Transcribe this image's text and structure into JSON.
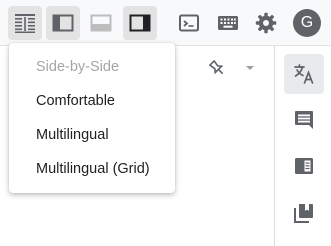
{
  "toolbar": {
    "buttons": [
      {
        "icon": "side-by-side-layout-icon",
        "active": true
      },
      {
        "icon": "left-panel-layout-icon",
        "active": true
      },
      {
        "icon": "bottom-panel-layout-icon",
        "active": false
      },
      {
        "icon": "right-panel-layout-icon",
        "active": true
      },
      {
        "icon": "terminal-icon",
        "active": false
      },
      {
        "icon": "keyboard-icon",
        "active": false
      },
      {
        "icon": "gear-icon",
        "active": false
      }
    ],
    "avatar_letter": "G"
  },
  "layout_menu": {
    "items": [
      {
        "label": "Side-by-Side",
        "disabled": true
      },
      {
        "label": "Comfortable",
        "disabled": false
      },
      {
        "label": "Multilingual",
        "disabled": false
      },
      {
        "label": "Multilingual (Grid)",
        "disabled": false
      }
    ]
  },
  "right_sidebar": {
    "buttons": [
      {
        "icon": "translate-icon",
        "active": true
      },
      {
        "icon": "comment-icon",
        "active": false
      },
      {
        "icon": "book-icon",
        "active": false
      },
      {
        "icon": "bookmarks-icon",
        "active": false
      }
    ]
  },
  "colors": {
    "icon": "#5f6368",
    "active_bg": "#e3e3e3",
    "avatar_bg": "#5f6368",
    "disabled_text": "#a6a6a6"
  }
}
